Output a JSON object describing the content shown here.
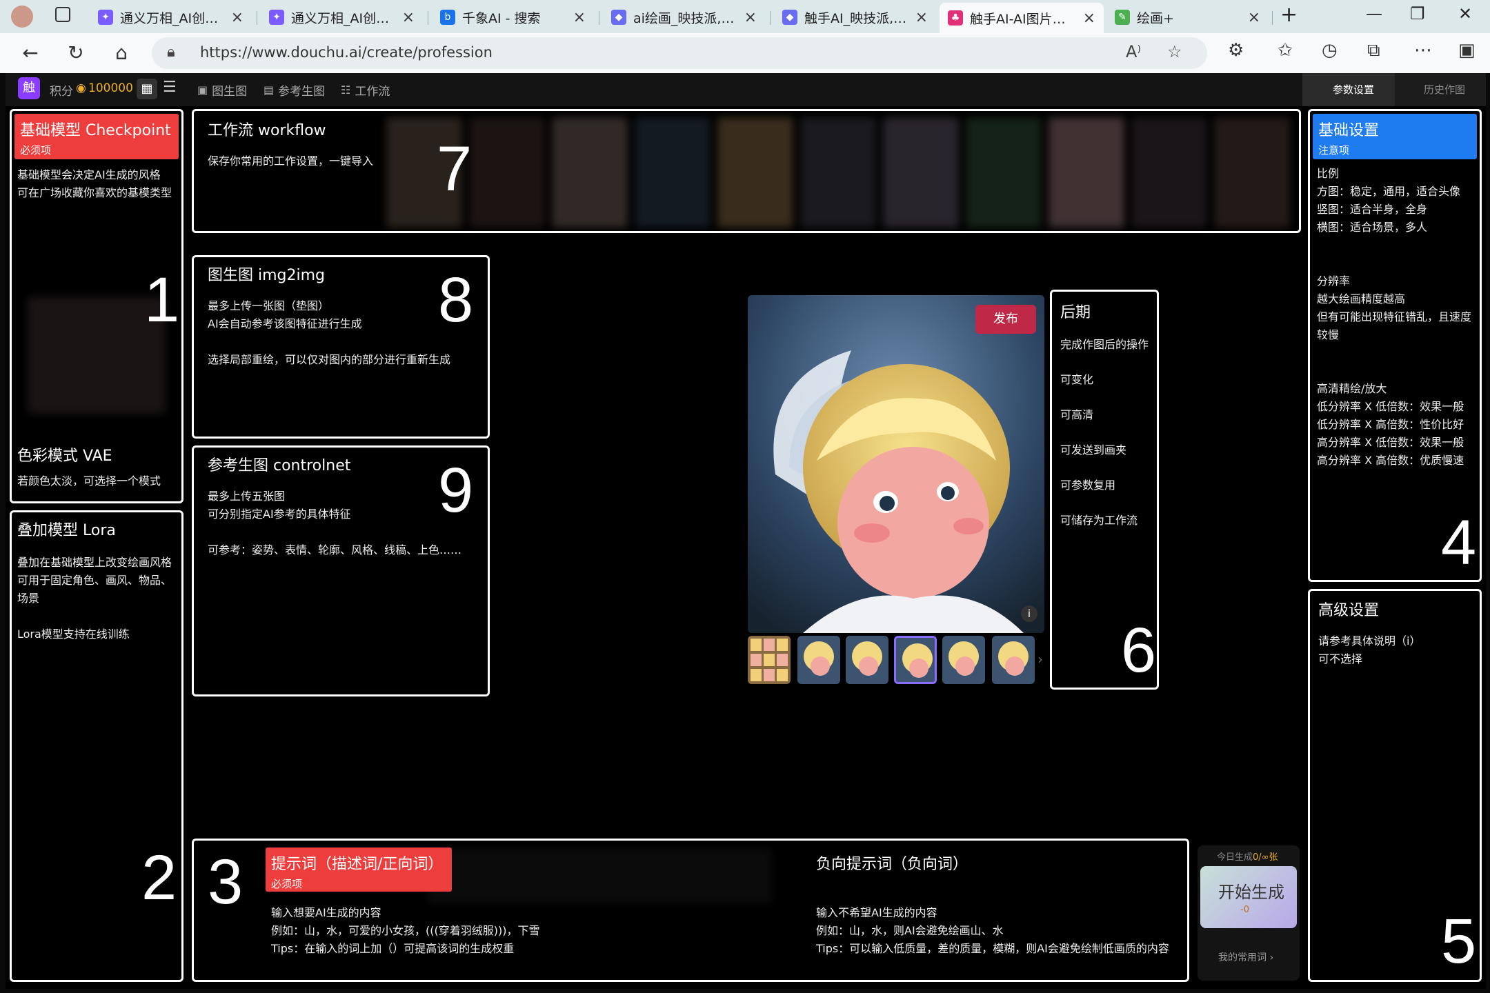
{
  "browser": {
    "tabs": [
      {
        "title": "通义万相_AI创意作",
        "icon": "tongyi-icon",
        "color": "#7b5cff"
      },
      {
        "title": "通义万相_AI创意作",
        "icon": "tongyi-icon",
        "color": "#7b5cff"
      },
      {
        "title": "千象AI - 搜索",
        "icon": "bing-icon",
        "color": "#1a73e8"
      },
      {
        "title": "ai绘画_映技派,专注",
        "icon": "yingjipai-icon",
        "color": "#6a6cf0"
      },
      {
        "title": "触手AI_映技派,专注",
        "icon": "yingjipai-icon",
        "color": "#6a6cf0"
      },
      {
        "title": "触手AI-AI图片生成",
        "icon": "chushou-icon",
        "color": "#e0307a"
      },
      {
        "title": "绘画+",
        "icon": "pen-icon",
        "color": "#4caf50"
      }
    ],
    "url": "https://www.douchu.ai/create/profession"
  },
  "nav": {
    "points_label": "积分",
    "points_value": "100000",
    "tabs": [
      "图生图",
      "参考生图",
      "工作流"
    ],
    "right_tabs": [
      "参数设置",
      "历史作图"
    ]
  },
  "guides": {
    "checkpoint": {
      "title": "基础模型 Checkpoint",
      "required": "必须项",
      "text": "基础模型会决定AI生成的风格\n可在广场收藏你喜欢的基模类型",
      "num": "1"
    },
    "vae": {
      "title": "色彩模式 VAE",
      "text": "若颜色太淡，可选择一个模式"
    },
    "lora": {
      "title": "叠加模型 Lora",
      "text": "叠加在基础模型上改变绘画风格\n可用于固定角色、画风、物品、场景\n\nLora模型支持在线训练",
      "num": "2"
    },
    "prompt": {
      "title": "提示词（描述词/正向词）",
      "required": "必须项",
      "text": "输入想要AI生成的内容\n例如：山，水，可爱的小女孩，(((穿着羽绒服)))，下雪\nTips：在输入的词上加（）可提高该词的生成权重",
      "num": "3"
    },
    "negative": {
      "title": "负向提示词（负向词）",
      "text": "输入不希望AI生成的内容\n例如：山，水，则AI会避免绘画山、水\nTips：可以输入低质量，差的质量，模糊，则AI会避免绘制低画质的内容"
    },
    "basic": {
      "title": "基础设置",
      "note": "注意项",
      "text": "比例\n方图：稳定，通用，适合头像\n竖图：适合半身，全身\n横图：适合场景，多人\n\n\n分辨率\n越大绘画精度越高\n但有可能出现特征错乱，且速度较慢\n\n\n高清精绘/放大\n低分辨率 X 低倍数：效果一般\n低分辨率 X 高倍数：性价比好\n高分辨率 X 低倍数：效果一般\n高分辨率 X 高倍数：优质慢速",
      "num": "4"
    },
    "advanced": {
      "title": "高级设置",
      "text": "请参考具体说明（i）\n可不选择",
      "num": "5"
    },
    "post": {
      "title": "后期",
      "items": [
        "完成作图后的操作",
        "可变化",
        "可高清",
        "可发送到画夹",
        "可参数复用",
        "可储存为工作流"
      ],
      "num": "6"
    },
    "workflow": {
      "title": "工作流 workflow",
      "text": "保存你常用的工作设置，一键导入",
      "num": "7"
    },
    "img2img": {
      "title": "图生图 img2img",
      "text": "最多上传一张图（垫图）\nAI会自动参考该图特征进行生成\n\n选择局部重绘，可以仅对图内的部分进行重新生成",
      "num": "8"
    },
    "controlnet": {
      "title": "参考生图 controlnet",
      "text": "最多上传五张图\n可分别指定AI参考的具体特征\n\n可参考：姿势、表情、轮廓、风格、线稿、上色……",
      "num": "9"
    }
  },
  "image_panel": {
    "publish": "发布",
    "info": "i"
  },
  "generate": {
    "today_label": "今日生成",
    "today_value": "0/∞张",
    "button": "开始生成",
    "cost": "-0",
    "common_words": "我的常用词 ›"
  },
  "colors": {
    "required_red": "#ee3d3d",
    "basic_blue": "#1f7bf0",
    "publish_red": "#c02848"
  }
}
